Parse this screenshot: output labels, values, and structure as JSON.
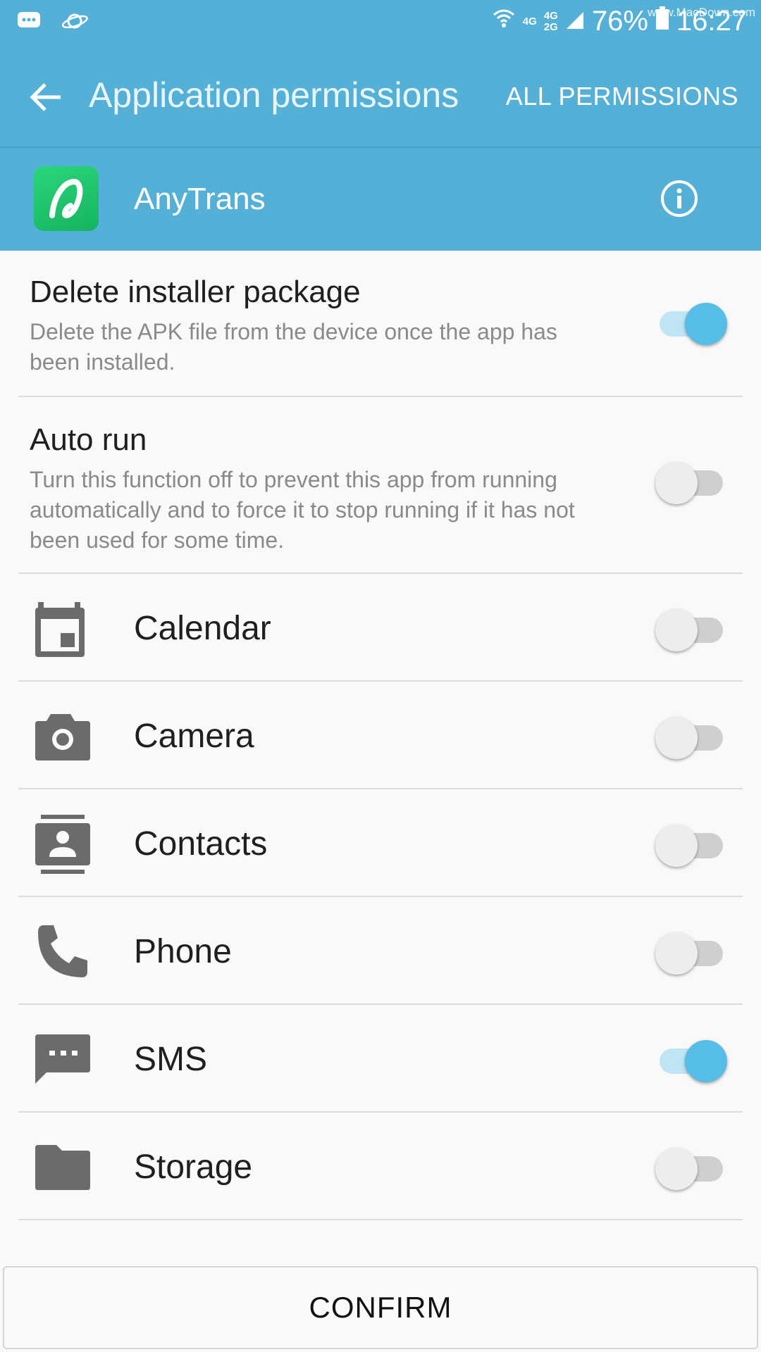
{
  "status_bar": {
    "network_top": "4G",
    "network_right_top": "4G",
    "network_right_bottom": "2G",
    "battery": "76%",
    "time": "16:27",
    "watermark": "www.MacDown.com",
    "icons": [
      "message-icon",
      "planet-icon",
      "wifi-icon",
      "signal-icon",
      "battery-icon"
    ]
  },
  "appbar": {
    "title": "Application permissions",
    "action_label": "ALL PERMISSIONS"
  },
  "app": {
    "name": "AnyTrans",
    "icon": "anytrans-logo",
    "icon_color": "#1fc56d"
  },
  "settings": [
    {
      "title": "Delete installer package",
      "subtitle": "Delete the APK file from the device once the app has been installed.",
      "enabled": true
    },
    {
      "title": "Auto run",
      "subtitle": "Turn this function off to prevent this app from running automatically and to force it to stop running if it has not been used for some time.",
      "enabled": false
    }
  ],
  "permissions": [
    {
      "label": "Calendar",
      "icon": "calendar-icon",
      "enabled": false
    },
    {
      "label": "Camera",
      "icon": "camera-icon",
      "enabled": false
    },
    {
      "label": "Contacts",
      "icon": "contacts-icon",
      "enabled": false
    },
    {
      "label": "Phone",
      "icon": "phone-icon",
      "enabled": false
    },
    {
      "label": "SMS",
      "icon": "sms-icon",
      "enabled": true
    },
    {
      "label": "Storage",
      "icon": "folder-icon",
      "enabled": false
    }
  ],
  "confirm_label": "CONFIRM",
  "colors": {
    "header": "#55b0d7",
    "switch_on": "#56bde6",
    "switch_off": "#ededed"
  }
}
